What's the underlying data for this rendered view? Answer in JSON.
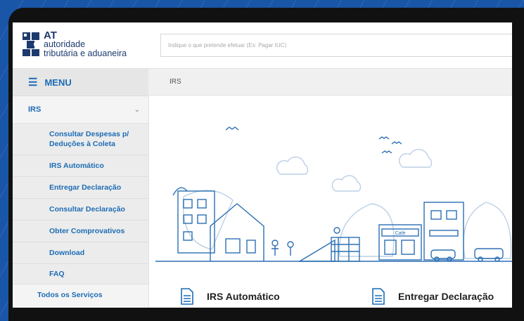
{
  "logo": {
    "at": "AT",
    "line1": "autoridade",
    "line2": "tributária e aduaneira"
  },
  "search": {
    "placeholder": "Indique o que pretende efetuar (Ex: Pagar IUC)",
    "value": ""
  },
  "menu": {
    "title": "MENU"
  },
  "nav": {
    "section": "IRS",
    "items": [
      "Consultar Despesas p/ Deduções à Coleta",
      "IRS Automático",
      "Entregar Declaração",
      "Consultar Declaração",
      "Obter Comprovativos",
      "Download",
      "FAQ"
    ],
    "all_services": "Todos os Serviços"
  },
  "breadcrumb": "IRS",
  "cards": [
    {
      "title": "IRS Automático",
      "icon": "document-icon"
    },
    {
      "title": "Entregar Declaração",
      "icon": "document-icon"
    }
  ],
  "illustration": {
    "sign": "Café"
  },
  "colors": {
    "accent": "#1c6cb5",
    "background": "#1a56a8",
    "frame": "#111111"
  }
}
